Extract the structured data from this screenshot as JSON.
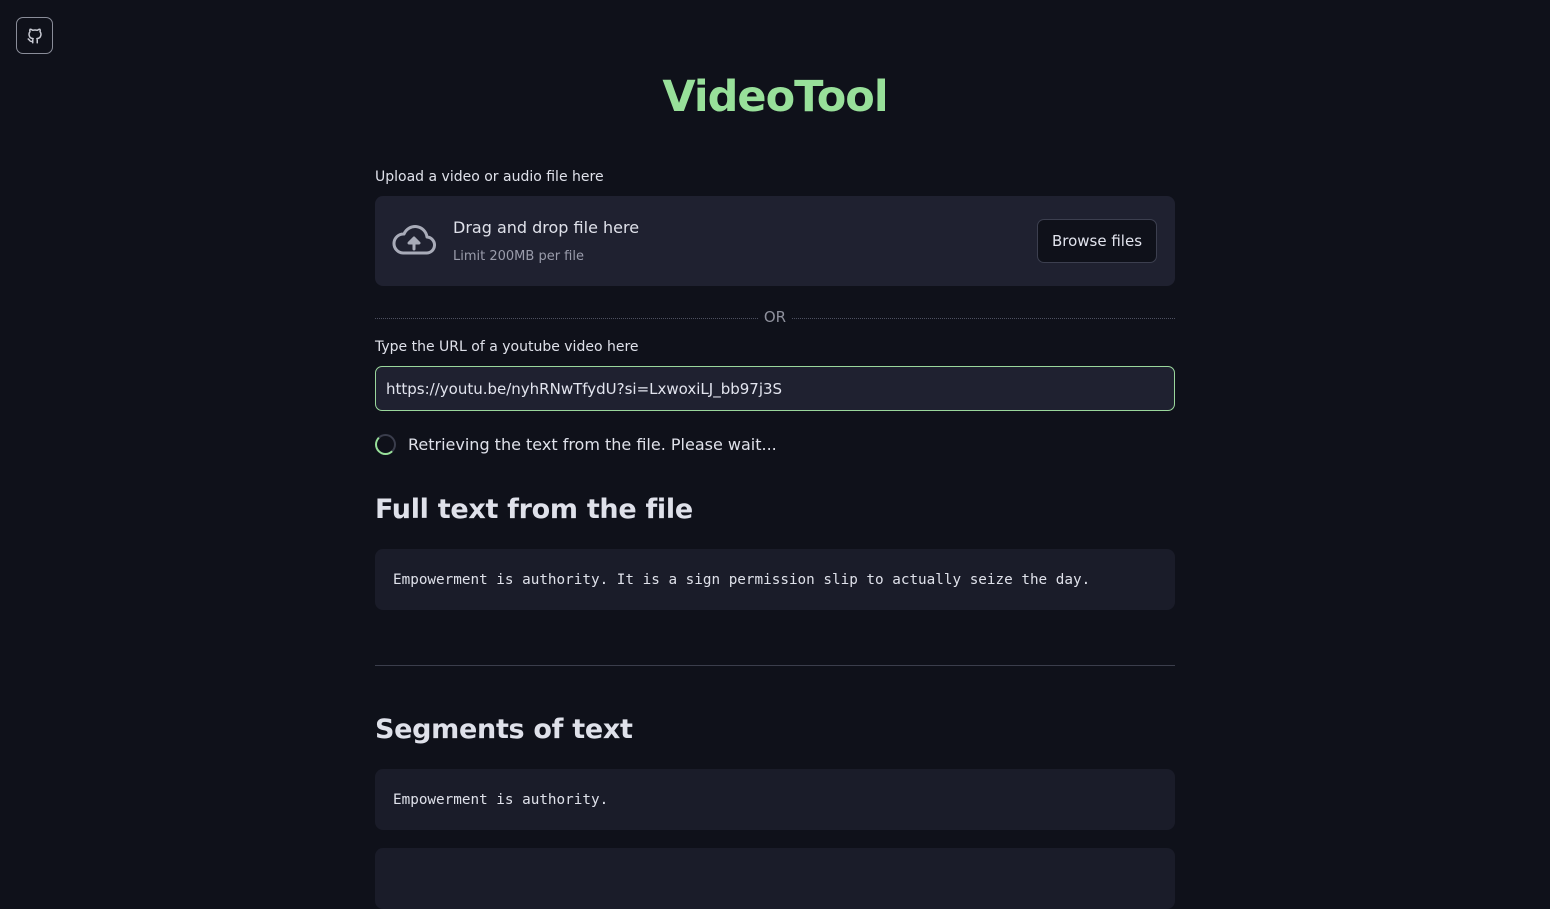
{
  "app": {
    "title": "VideoTool"
  },
  "upload": {
    "label": "Upload a video or audio file here",
    "drag_text": "Drag and drop file here",
    "limit_text": "Limit 200MB per file",
    "browse_label": "Browse files"
  },
  "divider": {
    "or_text": "OR"
  },
  "url": {
    "label": "Type the URL of a youtube video here",
    "value": "https://youtu.be/nyhRNwTfydU?si=LxwoxiLJ_bb97j3S"
  },
  "status": {
    "text": "Retrieving the text from the file. Please wait..."
  },
  "full_text": {
    "heading": "Full text from the file",
    "content": "Empowerment is authority. It is a sign permission slip to actually seize the day."
  },
  "segments": {
    "heading": "Segments of text",
    "items": [
      "Empowerment is authority.",
      ""
    ]
  },
  "icons": {
    "github": "github-icon",
    "cloud_upload": "cloud-upload-icon",
    "spinner": "spinner-icon"
  },
  "colors": {
    "background": "#0f111a",
    "accent": "#98e09a",
    "panel": "#1f2130"
  }
}
